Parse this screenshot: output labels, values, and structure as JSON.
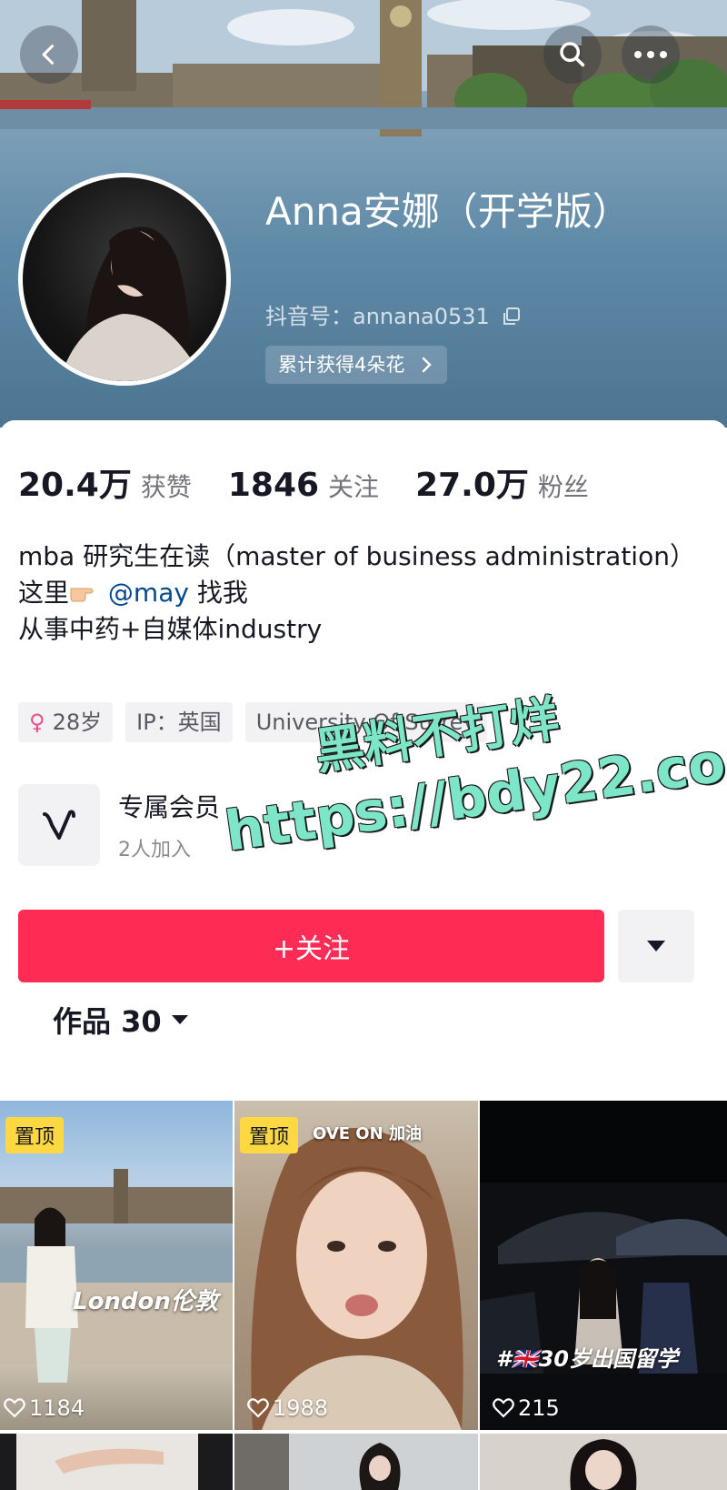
{
  "header": {
    "nickname": "Anna安娜（开学版）",
    "douyin_id": "抖音号：annana0531",
    "flowers": "累计获得4朵花"
  },
  "stats": [
    {
      "num": "20.4万",
      "label": "获赞"
    },
    {
      "num": "1846",
      "label": "关注"
    },
    {
      "num": "27.0万",
      "label": "粉丝"
    }
  ],
  "bio": {
    "line1": "mba 研究生在读（master of business administration）",
    "line2_pre": "这里",
    "line2_mention": "@may",
    "line2_post": " 找我",
    "line3": "从事中药+自媒体industry"
  },
  "tags": {
    "age": "28岁",
    "ip": "IP：英国",
    "school": "University Of Surrey"
  },
  "member": {
    "title": "专属会员",
    "subtitle": "2人加入"
  },
  "watermark": {
    "line1": "黑料不打烊",
    "line2": "https://bdy22.co"
  },
  "actions": {
    "follow_label": "+关注"
  },
  "works": {
    "tab_label": "作品 30"
  },
  "videos": [
    {
      "pinned": "置顶",
      "likes": "1184",
      "caption": "London伦敦"
    },
    {
      "pinned": "置顶",
      "likes": "1988",
      "caption": "OVE ON 加油"
    },
    {
      "pinned": "",
      "likes": "215",
      "caption": "#🇬🇧30岁出国留学"
    }
  ],
  "colors": {
    "accent": "#fe2c55",
    "pin_badge": "#fdd843",
    "mention": "#04498d"
  }
}
